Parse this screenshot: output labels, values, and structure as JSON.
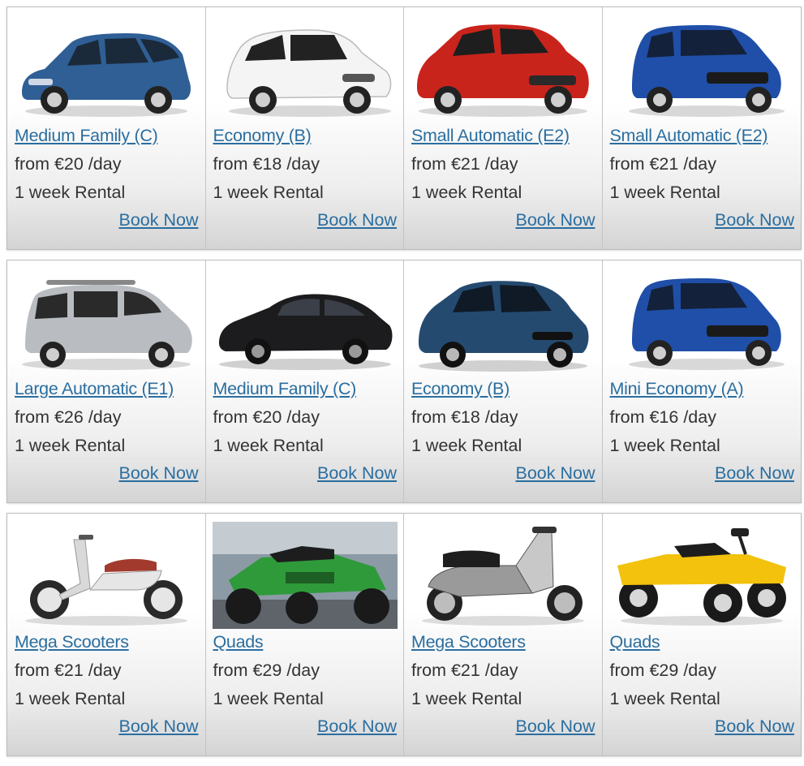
{
  "rows": [
    [
      {
        "name": "Medium Family (C)",
        "price": "from €20 /day",
        "rental": "1 week Rental",
        "book": "Book Now",
        "image": "blue-hatchback-car-image",
        "color": "#2f5f95"
      },
      {
        "name": "Economy (B)",
        "price": "from €18 /day",
        "rental": "1 week Rental",
        "book": "Book Now",
        "image": "white-hatchback-car-image",
        "color": "#f2f2f2"
      },
      {
        "name": "Small Automatic (E2)",
        "price": "from €21 /day",
        "rental": "1 week Rental",
        "book": "Book Now",
        "image": "red-small-car-image",
        "color": "#c9241c"
      },
      {
        "name": "Small Automatic (E2)",
        "price": "from €21 /day",
        "rental": "1 week Rental",
        "book": "Book Now",
        "image": "blue-small-car-image",
        "color": "#1f4fa8"
      }
    ],
    [
      {
        "name": "Large Automatic (E1)",
        "price": "from €26 /day",
        "rental": "1 week Rental",
        "book": "Book Now",
        "image": "silver-minivan-car-image",
        "color": "#b9bcc0"
      },
      {
        "name": "Medium Family (C)",
        "price": "from €20 /day",
        "rental": "1 week Rental",
        "book": "Book Now",
        "image": "black-sedan-car-image",
        "color": "#1c1c1e"
      },
      {
        "name": "Economy (B)",
        "price": "from €18 /day",
        "rental": "1 week Rental",
        "book": "Book Now",
        "image": "dark-blue-hatchback-car-image",
        "color": "#254a70"
      },
      {
        "name": "Mini Economy (A)",
        "price": "from €16 /day",
        "rental": "1 week Rental",
        "book": "Book Now",
        "image": "blue-mini-car-image",
        "color": "#1f4fa8"
      }
    ],
    [
      {
        "name": "Mega Scooters",
        "price": "from €21 /day",
        "rental": "1 week Rental",
        "book": "Book Now",
        "image": "white-scooter-image",
        "color": "#a33a2e"
      },
      {
        "name": "Quads",
        "price": "from €29 /day",
        "rental": "1 week Rental",
        "book": "Book Now",
        "image": "green-quad-bike-image",
        "color": "#2f9a3a"
      },
      {
        "name": "Mega Scooters",
        "price": "from €21 /day",
        "rental": "1 week Rental",
        "book": "Book Now",
        "image": "silver-scooter-image",
        "color": "#9a9a9a"
      },
      {
        "name": "Quads",
        "price": "from €29 /day",
        "rental": "1 week Rental",
        "book": "Book Now",
        "image": "yellow-quad-bike-image",
        "color": "#f2c20c"
      }
    ]
  ]
}
